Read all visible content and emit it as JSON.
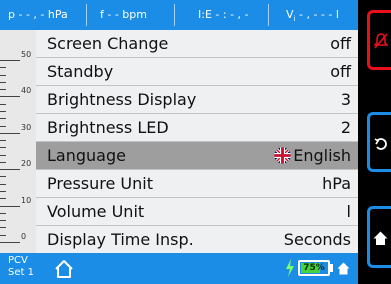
{
  "top_bar": {
    "pressure": "p - - , -  hPa",
    "frequency": "f - -  bpm",
    "ie_ratio": "I:E - : - , -",
    "volume": "V",
    "volume_sub": "i",
    "volume_value": " - , - - -  l"
  },
  "scale": {
    "labels": [
      "50",
      "40",
      "30",
      "20",
      "10",
      "0"
    ]
  },
  "menu": {
    "items": [
      {
        "label": "Screen Change",
        "value": "off"
      },
      {
        "label": "Standby",
        "value": "off"
      },
      {
        "label": "Brightness Display",
        "value": "3"
      },
      {
        "label": "Brightness LED",
        "value": "2"
      },
      {
        "label": "Language",
        "value": "English",
        "selected": true
      },
      {
        "label": "Pressure Unit",
        "value": "hPa"
      },
      {
        "label": "Volume Unit",
        "value": "l"
      },
      {
        "label": "Display Time Insp.",
        "value": "Seconds"
      }
    ]
  },
  "bottom_bar": {
    "mode": "PCV",
    "set": "Set 1",
    "battery_percent": "75%",
    "battery_level": 0.75
  },
  "side_keys": {
    "alarm_color": "#e8101c",
    "neutral_color": "#1c8de6"
  },
  "colors": {
    "accent": "#1c8de6",
    "selected_row": "#9e9e9e",
    "battery_fill": "#47d33b",
    "alarm": "#e8101c"
  }
}
